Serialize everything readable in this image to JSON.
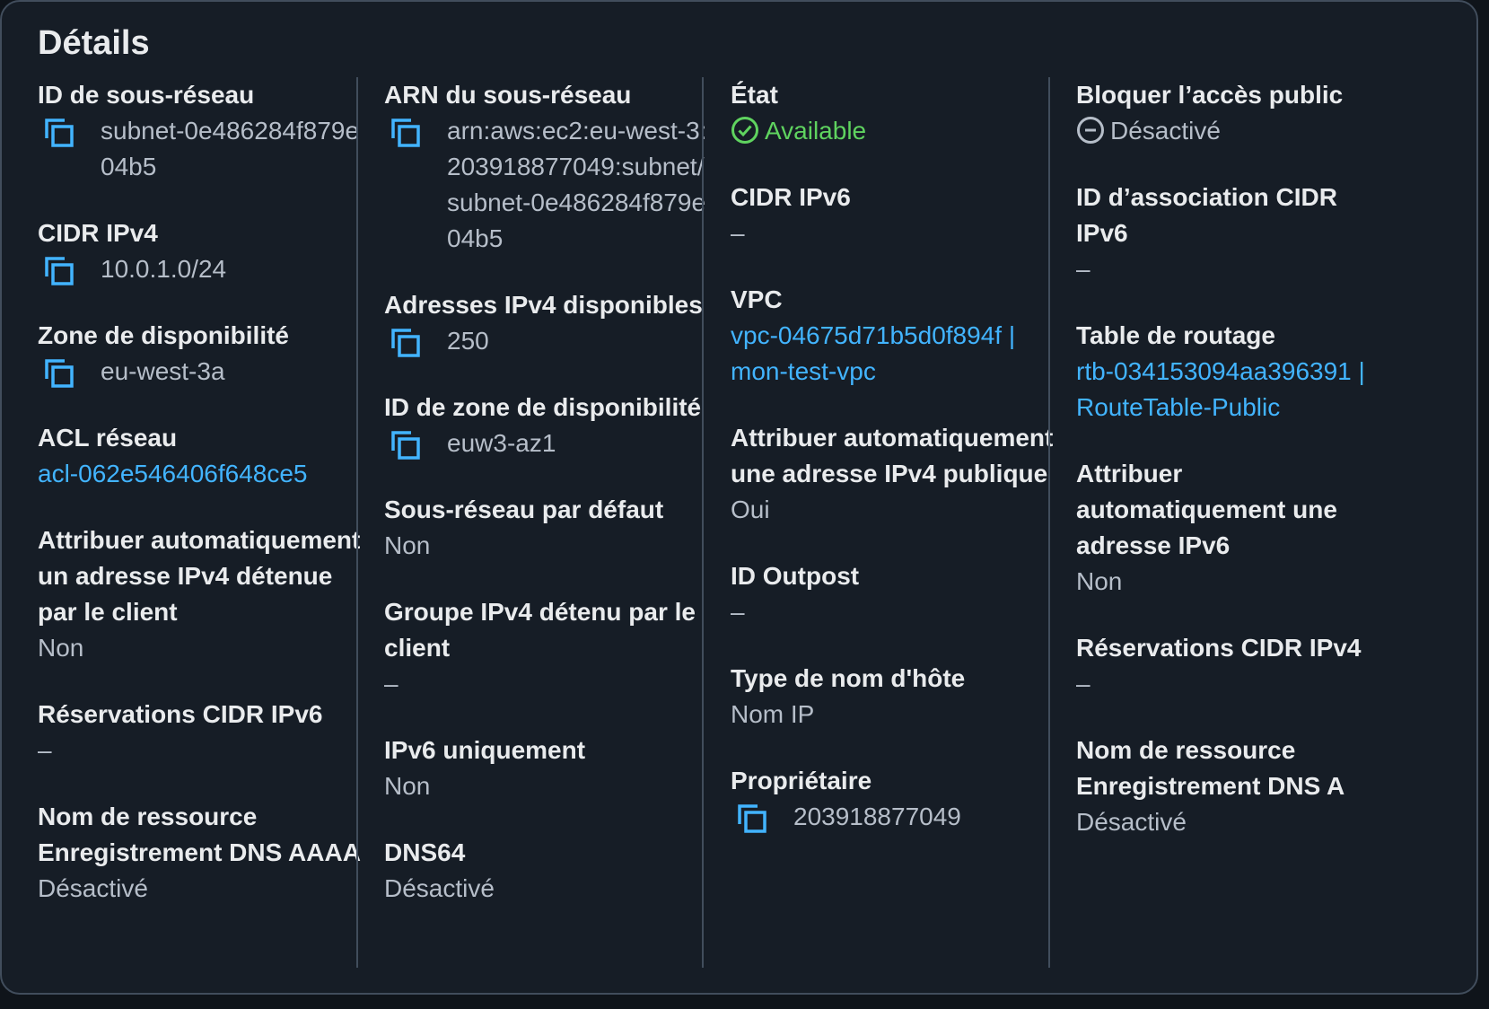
{
  "title": "Détails",
  "columns": [
    {
      "fields": [
        {
          "label": "ID de sous-réseau",
          "value": "subnet-0e486284f879e04b5",
          "copy": true
        },
        {
          "label": "CIDR IPv4",
          "value": "10.0.1.0/24",
          "copy": true
        },
        {
          "label": "Zone de disponibilité",
          "value": "eu-west-3a",
          "copy": true
        },
        {
          "label": "ACL réseau",
          "value": "acl-062e546406f648ce5",
          "link": true
        },
        {
          "label": "Attribuer automatiquement un adresse IPv4 détenue par le client",
          "value": "Non"
        },
        {
          "label": "Réservations CIDR IPv6",
          "value": "–"
        },
        {
          "label": "Nom de ressource Enregistrement DNS AAAA",
          "value": "Désactivé"
        }
      ]
    },
    {
      "fields": [
        {
          "label": "ARN du sous-réseau",
          "value": "arn:aws:ec2:eu-west-3:203918877049:subnet/subnet-0e486284f879e04b5",
          "copy": true
        },
        {
          "label": "Adresses IPv4 disponibles",
          "value": "250",
          "copy": true
        },
        {
          "label": "ID de zone de disponibilité",
          "value": "euw3-az1",
          "copy": true
        },
        {
          "label": "Sous-réseau par défaut",
          "value": "Non"
        },
        {
          "label": "Groupe IPv4 détenu par le client",
          "value": "–"
        },
        {
          "label": "IPv6 uniquement",
          "value": "Non"
        },
        {
          "label": "DNS64",
          "value": "Désactivé"
        }
      ]
    },
    {
      "fields": [
        {
          "label": "État",
          "value": "Available",
          "status": "ok"
        },
        {
          "label": "CIDR IPv6",
          "value": "–"
        },
        {
          "label": "VPC",
          "value": "vpc-04675d71b5d0f894f | mon-test-vpc",
          "link": true
        },
        {
          "label": "Attribuer automatiquement une adresse IPv4 publique",
          "value": "Oui"
        },
        {
          "label": "ID Outpost",
          "value": "–"
        },
        {
          "label": "Type de nom d'hôte",
          "value": "Nom IP"
        },
        {
          "label": "Propriétaire",
          "value": "203918877049",
          "copy": true
        }
      ]
    },
    {
      "fields": [
        {
          "label": "Bloquer l’accès public",
          "value": "Désactivé",
          "status": "off"
        },
        {
          "label": "ID d’association CIDR IPv6",
          "value": "–"
        },
        {
          "label": "Table de routage",
          "value": "rtb-034153094aa396391 | RouteTable-Public",
          "link": true
        },
        {
          "label": "Attribuer automatiquement une adresse IPv6",
          "value": "Non"
        },
        {
          "label": "Réservations CIDR IPv4",
          "value": "–"
        },
        {
          "label": "Nom de ressource Enregistrement DNS A",
          "value": "Désactivé"
        }
      ]
    }
  ],
  "colors": {
    "background": "#161d26",
    "label": "#e9ebed",
    "value": "#b6bec9",
    "link": "#42b4ff",
    "success": "#5fd35f",
    "border": "#414d5c"
  }
}
